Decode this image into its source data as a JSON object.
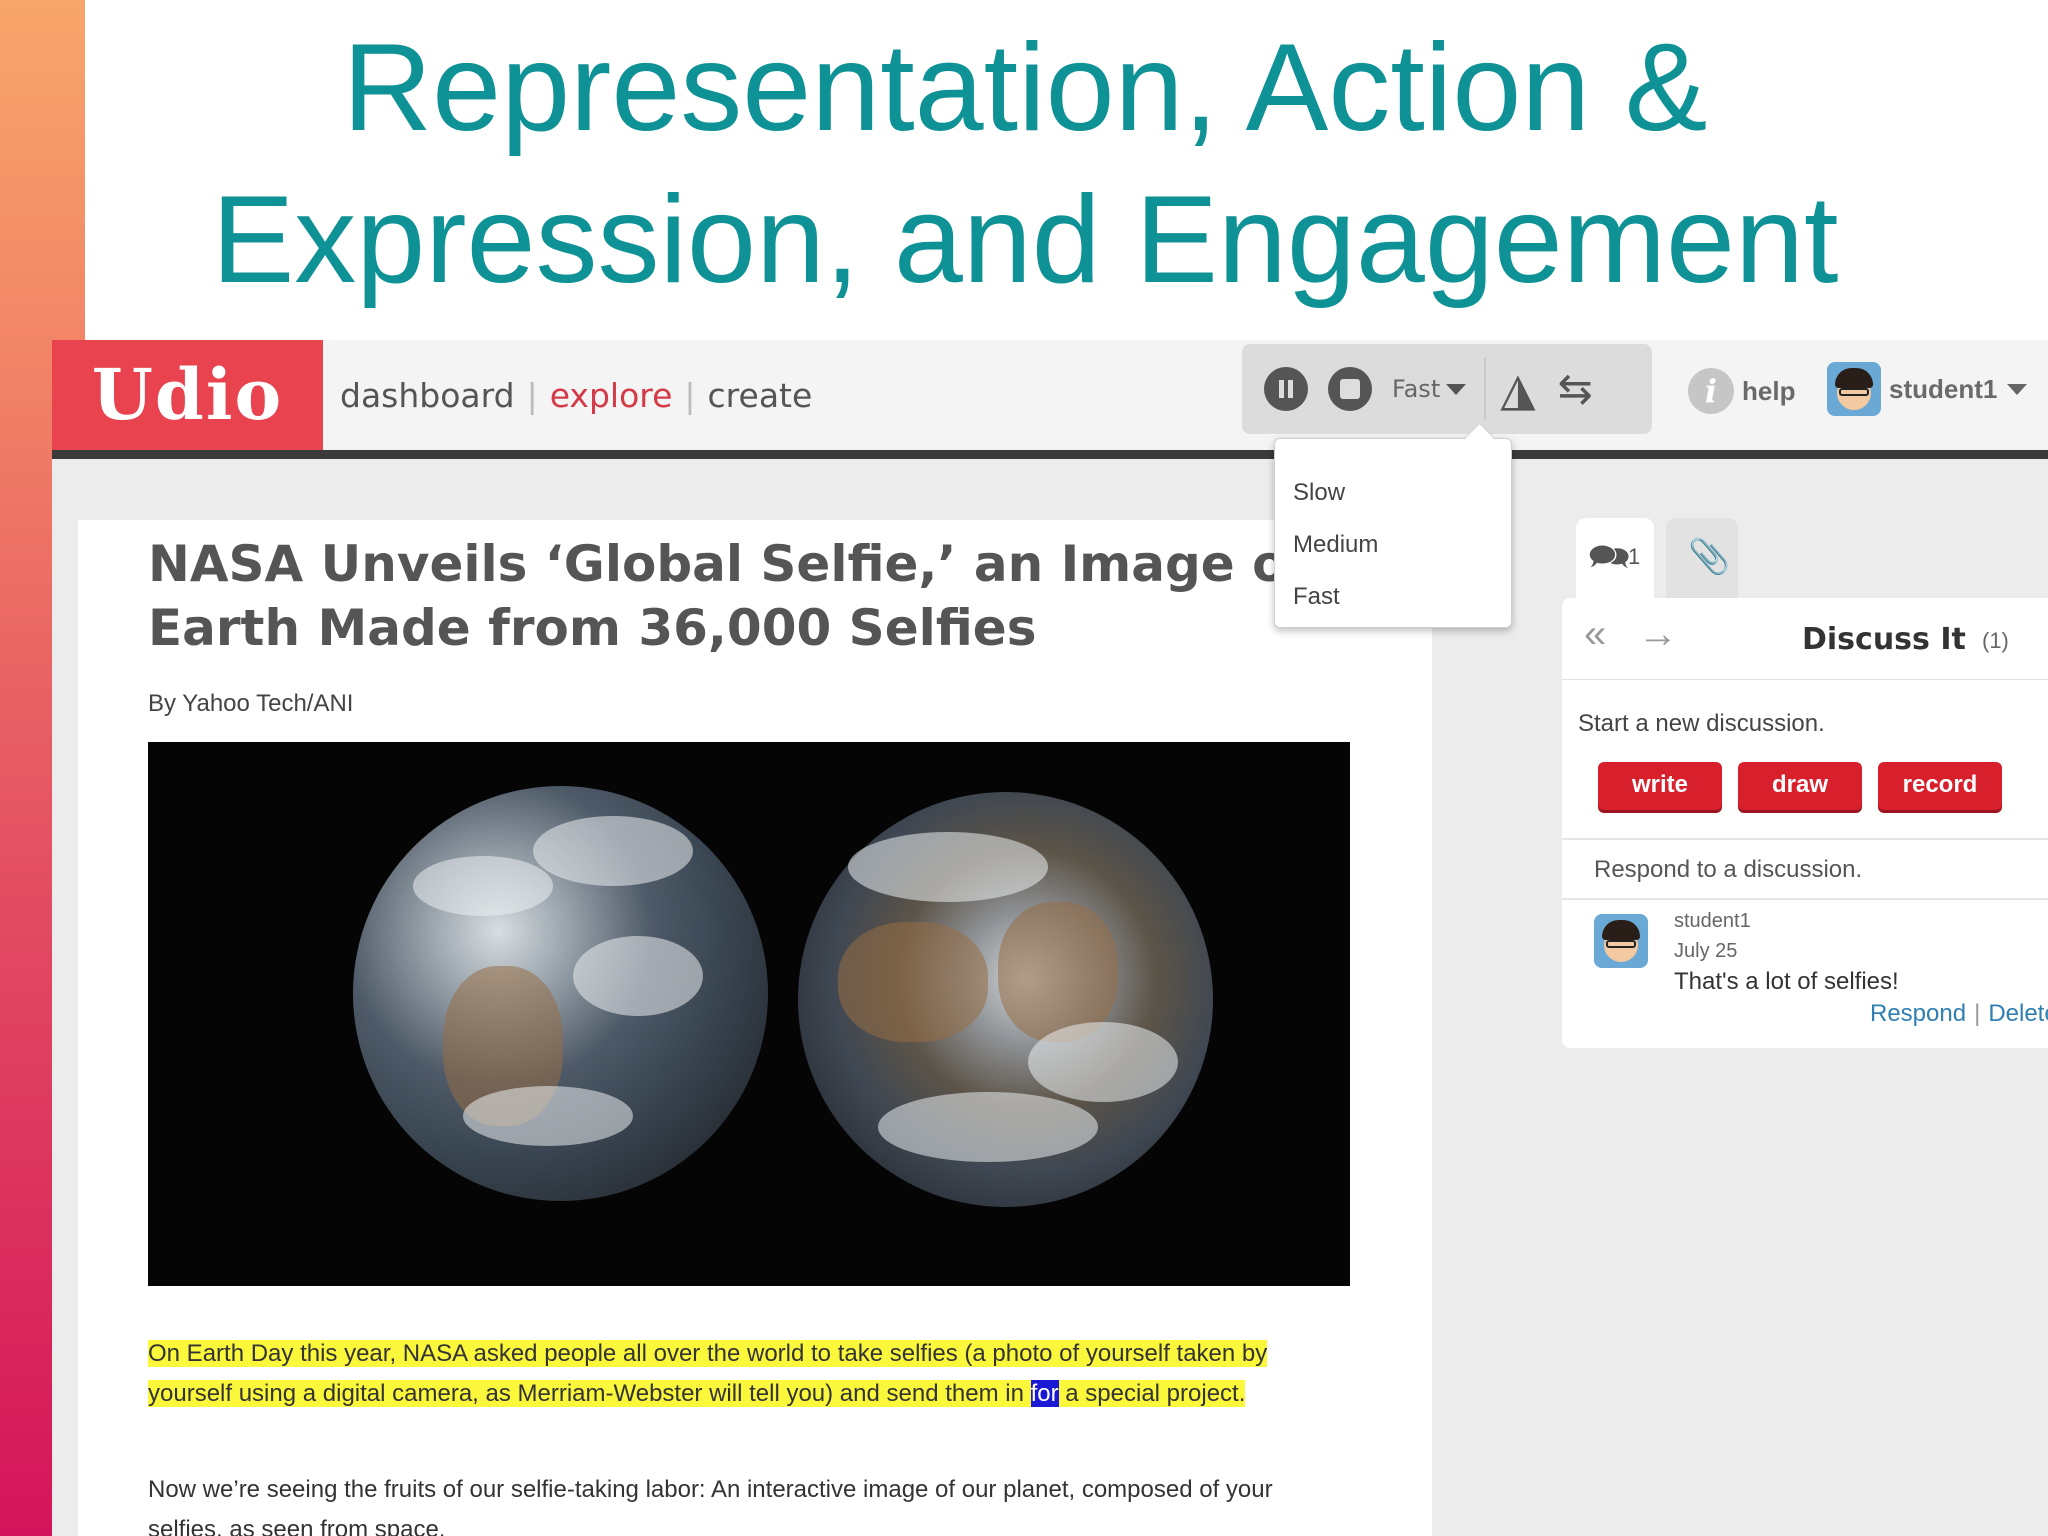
{
  "slide": {
    "title_line1": "Representation, Action &",
    "title_line2": "Expression, and Engagement"
  },
  "app": {
    "logo": "Udio",
    "nav": {
      "dashboard": "dashboard",
      "explore": "explore",
      "create": "create",
      "separator": "|",
      "active": "explore"
    },
    "toolbar": {
      "speed_selected": "Fast",
      "speed_options": [
        "Slow",
        "Medium",
        "Fast"
      ],
      "icons": [
        "pause-icon",
        "stop-icon",
        "book-icon",
        "swap-icon"
      ]
    },
    "help_label": "help",
    "user_label": "student1",
    "colors": {
      "brand_red": "#e8434e",
      "teal_title": "#0f9296",
      "highlight_yellow": "#fbf73a",
      "highlight_blue": "#1a1ad6",
      "button_red": "#d81f2c",
      "link_blue": "#2f7fb2"
    }
  },
  "article": {
    "headline": "NASA Unveils ‘Global Selfie,’ an Image o\nEarth Made from 36,000 Selfies",
    "byline": "By Yahoo Tech/ANI",
    "para1_before": "On Earth Day this year, NASA asked people all over the world to take selfies (a photo of yourself taken by yourself using a digital camera, as Merriam-Webster will tell you) and send them in ",
    "para1_word": "for",
    "para1_after": " a special project.",
    "para2": "Now we’re seeing the fruits of our selfie-taking labor: An interactive image of our planet, composed of your selfies, as seen from space."
  },
  "sidebar": {
    "tab_discuss_count": "1",
    "title": "Discuss It",
    "title_count": "(1)",
    "start_prompt": "Start a new discussion.",
    "buttons": {
      "write": "write",
      "draw": "draw",
      "record": "record"
    },
    "respond_prompt": "Respond to a discussion.",
    "comment": {
      "user": "student1",
      "date": "July 25",
      "text": "That's a lot of selfies!",
      "respond": "Respond",
      "separator": "|",
      "delete": "Delete"
    }
  }
}
